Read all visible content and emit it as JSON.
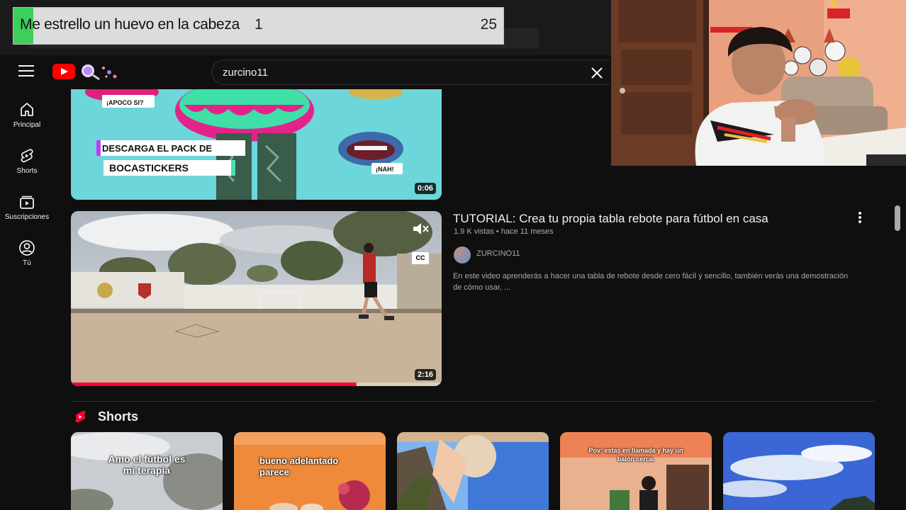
{
  "goal_overlay": {
    "title": "Me estrello un huevo en la cabeza",
    "current": "1",
    "target": "25",
    "progress": 0.04
  },
  "masthead": {
    "search_value": "zurcino11"
  },
  "guide": {
    "items": [
      {
        "label": "Principal",
        "icon": "home-icon"
      },
      {
        "label": "Shorts",
        "icon": "shorts-icon"
      },
      {
        "label": "Suscripciones",
        "icon": "subscriptions-icon"
      },
      {
        "label": "Tú",
        "icon": "account-icon"
      }
    ]
  },
  "video1": {
    "duration": "0:06",
    "thumb_text": {
      "sticker1": "¡APOCO SI?",
      "banner1": "DESCARGA EL PACK DE",
      "banner2": "BOCASTICKERS",
      "sticker2": "¡NAH!"
    }
  },
  "video2": {
    "title": "TUTORIAL: Crea tu propia tabla rebote para fútbol en casa",
    "meta": "1.9 K vistas • hace 11 meses",
    "channel": "ZURCINO11",
    "description": "En este video aprenderás a hacer una tabla de rebote desde cero fácil y sencillo, también verás una demostración de cómo usar, ...",
    "duration": "2:16",
    "cc_label": "CC",
    "progress": 0.77
  },
  "shorts": {
    "heading": "Shorts",
    "items": [
      {
        "caption": "Amo el fútbol es mi terapia"
      },
      {
        "caption": "bueno adelantado parece"
      },
      {
        "caption": ""
      },
      {
        "caption": "Pov: estas en llamada y hay un balón cerca."
      },
      {
        "caption": ""
      }
    ]
  },
  "colors": {
    "accent": "#ff0000",
    "background": "#0f0f0f",
    "goal_fill": "#3ccf5a"
  }
}
